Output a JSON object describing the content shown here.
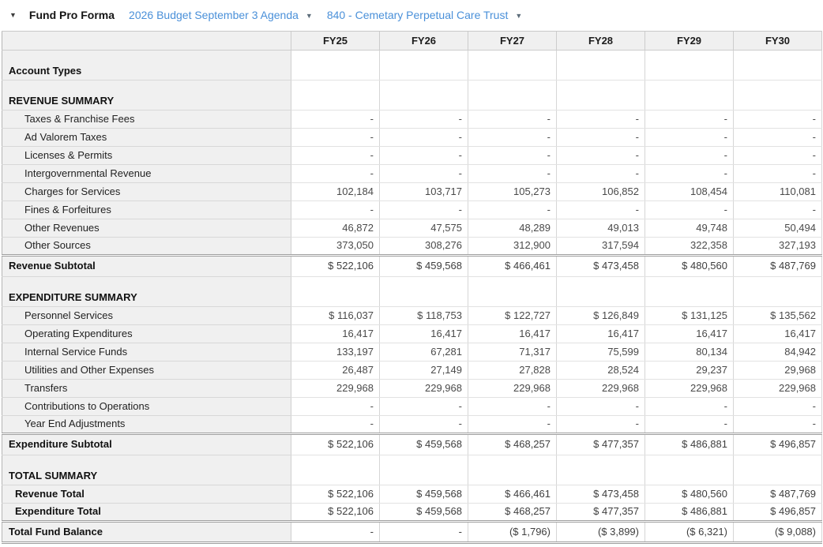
{
  "header": {
    "collapse_icon": "▼",
    "title": "Fund Pro Forma",
    "budget_selector_label": "2026 Budget September 3 Agenda",
    "fund_selector_label": "840 - Cemetary Perpetual Care Trust",
    "dropdown_icon": "▼"
  },
  "colors": {
    "link_blue": "#4a90d9",
    "label_column_bg": "#f0f0f0",
    "grid_line": "#d6d6d6",
    "double_rule": "#9e9e9e",
    "number_text": "#4a4a4a"
  },
  "table": {
    "columns": [
      "FY25",
      "FY26",
      "FY27",
      "FY28",
      "FY29",
      "FY30"
    ],
    "rows": [
      {
        "type": "section",
        "name": "account-types",
        "label": "Account Types",
        "values": [
          "",
          "",
          "",
          "",
          "",
          ""
        ]
      },
      {
        "type": "section",
        "name": "revenue-summary-header",
        "label": "REVENUE SUMMARY",
        "values": [
          "",
          "",
          "",
          "",
          "",
          ""
        ]
      },
      {
        "type": "detail",
        "name": "taxes-franchise-fees",
        "label": "Taxes & Franchise Fees",
        "values": [
          "-",
          "-",
          "-",
          "-",
          "-",
          "-"
        ]
      },
      {
        "type": "detail",
        "name": "ad-valorem-taxes",
        "label": "Ad Valorem Taxes",
        "values": [
          "-",
          "-",
          "-",
          "-",
          "-",
          "-"
        ]
      },
      {
        "type": "detail",
        "name": "licenses-permits",
        "label": "Licenses & Permits",
        "values": [
          "-",
          "-",
          "-",
          "-",
          "-",
          "-"
        ]
      },
      {
        "type": "detail",
        "name": "intergovernmental-revenue",
        "label": "Intergovernmental Revenue",
        "values": [
          "-",
          "-",
          "-",
          "-",
          "-",
          "-"
        ]
      },
      {
        "type": "detail",
        "name": "charges-for-services",
        "label": "Charges for Services",
        "values": [
          "102,184",
          "103,717",
          "105,273",
          "106,852",
          "108,454",
          "110,081"
        ]
      },
      {
        "type": "detail",
        "name": "fines-forfeitures",
        "label": "Fines & Forfeitures",
        "values": [
          "-",
          "-",
          "-",
          "-",
          "-",
          "-"
        ]
      },
      {
        "type": "detail",
        "name": "other-revenues",
        "label": "Other Revenues",
        "values": [
          "46,872",
          "47,575",
          "48,289",
          "49,013",
          "49,748",
          "50,494"
        ]
      },
      {
        "type": "detail",
        "name": "other-sources",
        "label": "Other Sources",
        "values": [
          "373,050",
          "308,276",
          "312,900",
          "317,594",
          "322,358",
          "327,193"
        ]
      },
      {
        "type": "subtotal",
        "name": "revenue-subtotal",
        "label": "Revenue Subtotal",
        "values": [
          "$ 522,106",
          "$ 459,568",
          "$ 466,461",
          "$ 473,458",
          "$ 480,560",
          "$ 487,769"
        ]
      },
      {
        "type": "section",
        "name": "expenditure-summary-header",
        "label": "EXPENDITURE SUMMARY",
        "values": [
          "",
          "",
          "",
          "",
          "",
          ""
        ]
      },
      {
        "type": "detail",
        "name": "personnel-services",
        "label": "Personnel Services",
        "values": [
          "$ 116,037",
          "$ 118,753",
          "$ 122,727",
          "$ 126,849",
          "$ 131,125",
          "$ 135,562"
        ]
      },
      {
        "type": "detail",
        "name": "operating-expenditures",
        "label": "Operating Expenditures",
        "values": [
          "16,417",
          "16,417",
          "16,417",
          "16,417",
          "16,417",
          "16,417"
        ]
      },
      {
        "type": "detail",
        "name": "internal-service-funds",
        "label": "Internal Service Funds",
        "values": [
          "133,197",
          "67,281",
          "71,317",
          "75,599",
          "80,134",
          "84,942"
        ]
      },
      {
        "type": "detail",
        "name": "utilities-other-expenses",
        "label": "Utilities and Other Expenses",
        "values": [
          "26,487",
          "27,149",
          "27,828",
          "28,524",
          "29,237",
          "29,968"
        ]
      },
      {
        "type": "detail",
        "name": "transfers",
        "label": "Transfers",
        "values": [
          "229,968",
          "229,968",
          "229,968",
          "229,968",
          "229,968",
          "229,968"
        ]
      },
      {
        "type": "detail",
        "name": "contributions-to-operations",
        "label": "Contributions to Operations",
        "values": [
          "-",
          "-",
          "-",
          "-",
          "-",
          "-"
        ]
      },
      {
        "type": "detail",
        "name": "year-end-adjustments",
        "label": "Year End Adjustments",
        "values": [
          "-",
          "-",
          "-",
          "-",
          "-",
          "-"
        ]
      },
      {
        "type": "subtotal",
        "name": "expenditure-subtotal",
        "label": "Expenditure Subtotal",
        "values": [
          "$ 522,106",
          "$ 459,568",
          "$ 468,257",
          "$ 477,357",
          "$ 486,881",
          "$ 496,857"
        ]
      },
      {
        "type": "section",
        "name": "total-summary-header",
        "label": "TOTAL SUMMARY",
        "values": [
          "",
          "",
          "",
          "",
          "",
          ""
        ]
      },
      {
        "type": "totalline",
        "name": "revenue-total",
        "label": "Revenue Total",
        "values": [
          "$ 522,106",
          "$ 459,568",
          "$ 466,461",
          "$ 473,458",
          "$ 480,560",
          "$ 487,769"
        ]
      },
      {
        "type": "totalline",
        "name": "expenditure-total",
        "label": "Expenditure Total",
        "values": [
          "$ 522,106",
          "$ 459,568",
          "$ 468,257",
          "$ 477,357",
          "$ 486,881",
          "$ 496,857"
        ]
      },
      {
        "type": "grand",
        "name": "total-fund-balance",
        "label": "Total Fund Balance",
        "values": [
          "-",
          "-",
          "($ 1,796)",
          "($ 3,899)",
          "($ 6,321)",
          "($ 9,088)"
        ]
      }
    ]
  }
}
